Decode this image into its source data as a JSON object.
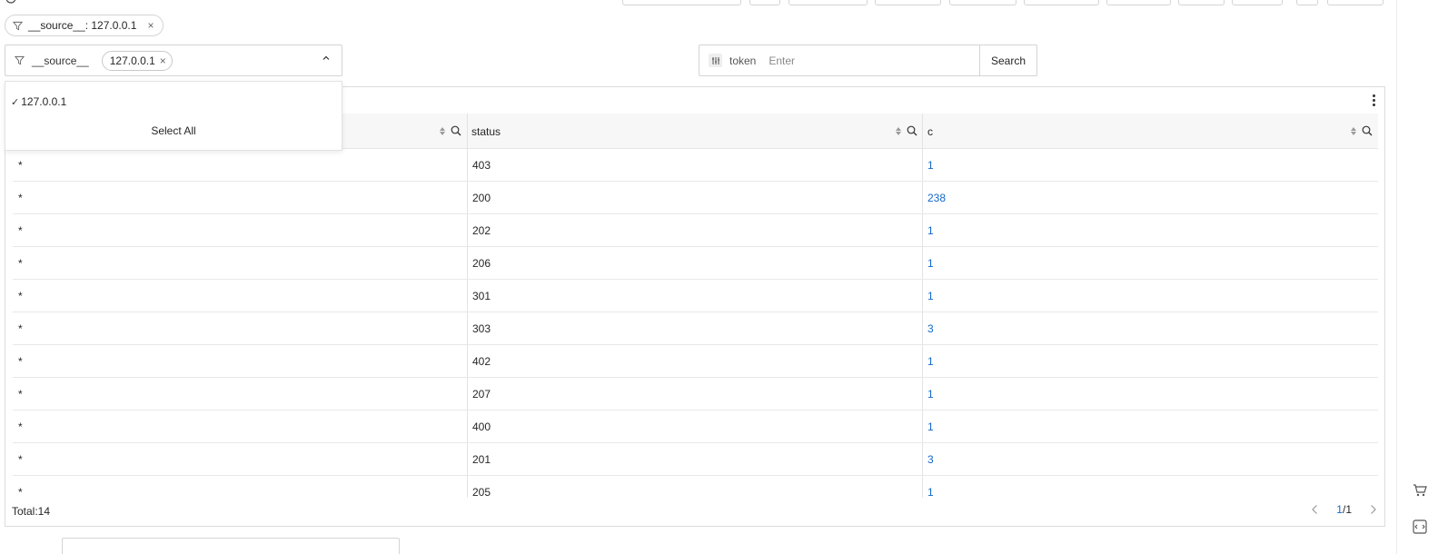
{
  "filter_tag": {
    "text": "__source__: 127.0.0.1",
    "close": "×"
  },
  "source_select": {
    "label": "__source__",
    "chip": "127.0.0.1",
    "chip_close": "×",
    "chevron": "^"
  },
  "dropdown": {
    "check": "✓",
    "option": "127.0.0.1",
    "select_all": "Select All"
  },
  "token_search": {
    "label": "token",
    "placeholder": "Enter",
    "button": "Search"
  },
  "table": {
    "headers": [
      "",
      "status",
      "c"
    ],
    "rows": [
      [
        "*",
        "403",
        "1"
      ],
      [
        "*",
        "200",
        "238"
      ],
      [
        "*",
        "202",
        "1"
      ],
      [
        "*",
        "206",
        "1"
      ],
      [
        "*",
        "301",
        "1"
      ],
      [
        "*",
        "303",
        "3"
      ],
      [
        "*",
        "402",
        "1"
      ],
      [
        "*",
        "207",
        "1"
      ],
      [
        "*",
        "400",
        "1"
      ],
      [
        "*",
        "201",
        "3"
      ],
      [
        "*",
        "205",
        "1"
      ]
    ],
    "total": "Total:14",
    "page_current": "1",
    "page_total": "/1"
  },
  "colors": {
    "link": "#1468c8",
    "border": "#d4d4d4",
    "header_bg": "#f7f7f8"
  },
  "icons": [
    "filter-icon",
    "close-icon",
    "chevron-up-icon",
    "check-icon",
    "token-icon",
    "sort-icon",
    "search-icon",
    "more-icon",
    "chevron-left-icon",
    "chevron-right-icon",
    "cart-icon",
    "code-icon"
  ]
}
